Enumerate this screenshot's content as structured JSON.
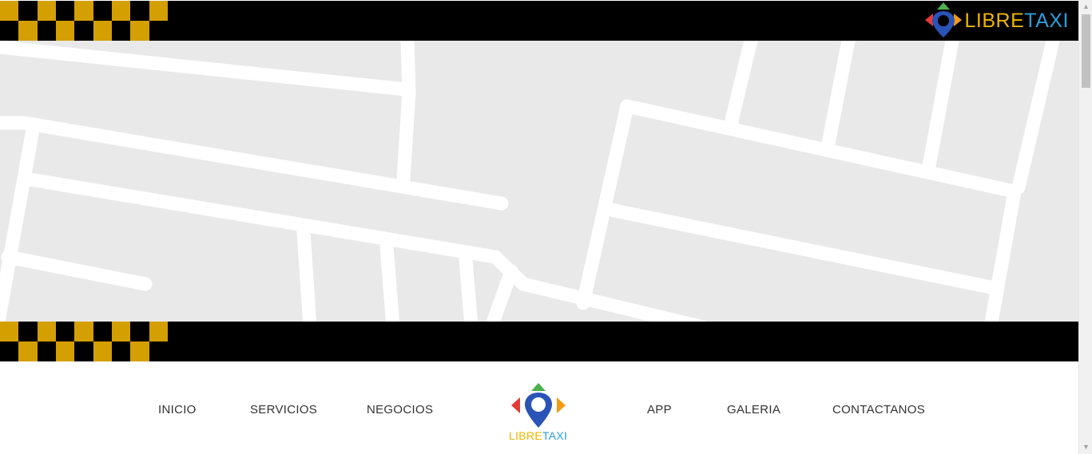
{
  "header": {
    "logo": {
      "text_part1": "LIBRE",
      "text_part2": "TAXI"
    }
  },
  "colors": {
    "checker_gold": "#d49f00",
    "band_black": "#000000",
    "map_background": "#e9e9e9",
    "map_roads": "#ffffff",
    "logo_libre": "#f0b400",
    "logo_taxi": "#2a9fdc",
    "pin_blue": "#2a53b8",
    "arrow_red": "#e53935",
    "arrow_green": "#4caf50",
    "arrow_orange": "#f39c12"
  },
  "nav": {
    "items": [
      {
        "label": "INICIO"
      },
      {
        "label": "SERVICIOS"
      },
      {
        "label": "NEGOCIOS"
      },
      {
        "label": "APP"
      },
      {
        "label": "GALERIA"
      },
      {
        "label": "CONTACTANOS"
      }
    ],
    "logo": {
      "text_part1": "LIBRE",
      "text_part2": "TAXI"
    }
  },
  "icons": {
    "logo_mark": "map-pin-compass-icon",
    "scroll_up": "chevron-up-icon",
    "scroll_down": "chevron-down-icon"
  }
}
